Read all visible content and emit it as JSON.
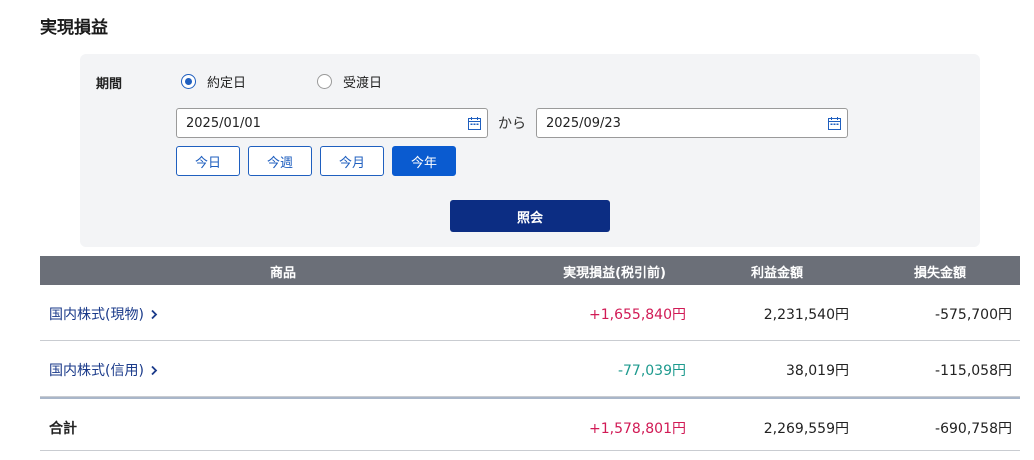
{
  "page": {
    "title": "実現損益"
  },
  "filter": {
    "period_label": "期間",
    "radio_options": [
      "約定日",
      "受渡日"
    ],
    "selected_radio": "約定日",
    "date_from": "2025/01/01",
    "date_to": "2025/09/23",
    "separator": "から",
    "quick_buttons": [
      "今日",
      "今週",
      "今月",
      "今年"
    ],
    "active_quick": "今年",
    "submit_label": "照会"
  },
  "table": {
    "headers": {
      "product": "商品",
      "realized_pl": "実現損益(税引前)",
      "profit": "利益金額",
      "loss": "損失金額"
    },
    "rows": [
      {
        "name": "国内株式(現物)",
        "realized_pl": "+1,655,840円",
        "profit": "2,231,540円",
        "loss": "-575,700円"
      },
      {
        "name": "国内株式(信用)",
        "realized_pl": "-77,039円",
        "profit": "38,019円",
        "loss": "-115,058円"
      }
    ],
    "total": {
      "name": "合計",
      "realized_pl": "+1,578,801円",
      "profit": "2,269,559円",
      "loss": "-690,758円"
    }
  },
  "colors": {
    "positive": "#d11a55",
    "negative": "#1d9a8e",
    "header_bg": "#6b6f78",
    "submit_bg": "#0c2d83",
    "accent": "#0a5bd0"
  }
}
